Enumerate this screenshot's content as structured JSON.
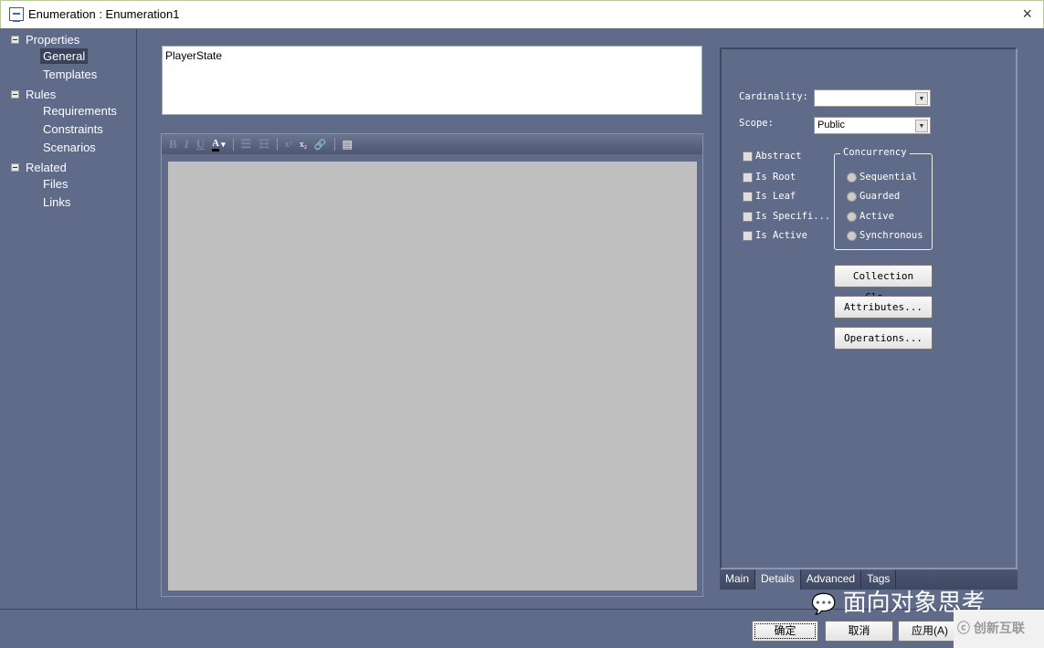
{
  "window": {
    "title": "Enumeration : Enumeration1",
    "close_icon": "×"
  },
  "sidebar": {
    "groups": [
      {
        "label": "Properties",
        "items": [
          "General",
          "Templates"
        ]
      },
      {
        "label": "Rules",
        "items": [
          "Requirements",
          "Constraints",
          "Scenarios"
        ]
      },
      {
        "label": "Related",
        "items": [
          "Files",
          "Links"
        ]
      }
    ],
    "selected": "General"
  },
  "name_field": {
    "value": "PlayerState"
  },
  "toolbar": {
    "bold": "B",
    "italic": "I",
    "underline": "U",
    "color": "A",
    "dropdown": "▾",
    "bullets": "☰",
    "numbering": "☷",
    "superscript": "x²",
    "subscript": "x₂",
    "hyperlink": "🔗",
    "attachment": "▤"
  },
  "details": {
    "cardinality_label": "Cardinality:",
    "cardinality_value": "",
    "scope_label": "Scope:",
    "scope_value": "Public",
    "checkboxes": [
      "Abstract",
      "Is Root",
      "Is Leaf",
      "Is Specifi...",
      "Is Active"
    ],
    "concurrency_label": "Concurrency",
    "radios": [
      "Sequential",
      "Guarded",
      "Active",
      "Synchronous"
    ],
    "collection_button": "Collection Cla...",
    "attributes_button": "Attributes...",
    "operations_button": "Operations..."
  },
  "tabs": [
    "Main",
    "Details",
    "Advanced",
    "Tags"
  ],
  "selected_tab": "Details",
  "footer": {
    "ok": "确定",
    "cancel": "取消",
    "apply": "应用(A)"
  },
  "watermark": {
    "text": "面向对象思考",
    "logo": "创新互联"
  }
}
